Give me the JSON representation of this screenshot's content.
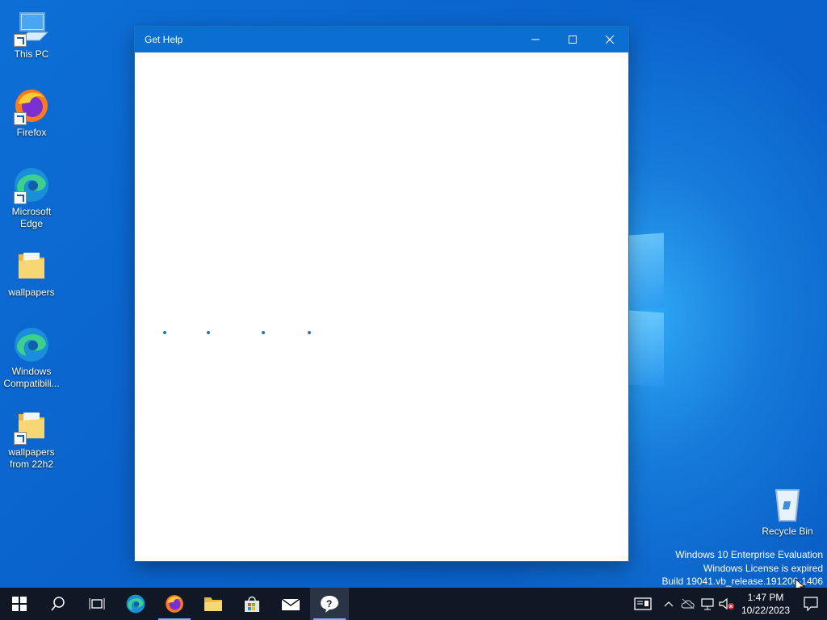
{
  "desktop": {
    "icons": [
      {
        "label": "This PC"
      },
      {
        "label": "Firefox"
      },
      {
        "label": "Microsoft Edge"
      },
      {
        "label": "wallpapers"
      },
      {
        "label": "Windows Compatibili..."
      },
      {
        "label": "wallpapers from 22h2"
      },
      {
        "label": "Recycle Bin"
      }
    ],
    "watermark": {
      "line1": "Windows 10 Enterprise Evaluation",
      "line2": "Windows License is expired",
      "line3": "Build 19041.vb_release.191206-1406"
    }
  },
  "window": {
    "title": "Get Help",
    "status": "loading"
  },
  "taskbar": {
    "items": [
      {
        "name": "start-button",
        "icon": "windows-logo-icon"
      },
      {
        "name": "search-button",
        "icon": "search-icon"
      },
      {
        "name": "task-view-button",
        "icon": "task-view-icon"
      },
      {
        "name": "edge-button",
        "icon": "edge-icon"
      },
      {
        "name": "firefox-button",
        "icon": "firefox-icon"
      },
      {
        "name": "file-explorer-button",
        "icon": "folder-icon"
      },
      {
        "name": "store-button",
        "icon": "store-icon"
      },
      {
        "name": "mail-button",
        "icon": "mail-icon"
      },
      {
        "name": "get-help-button",
        "icon": "help-icon",
        "active": true
      }
    ],
    "clock": {
      "time": "1:47 PM",
      "date": "10/22/2023"
    }
  },
  "colors": {
    "titlebar": "#0a6fd0",
    "taskbar": "#101826",
    "accent": "#0078d7"
  }
}
